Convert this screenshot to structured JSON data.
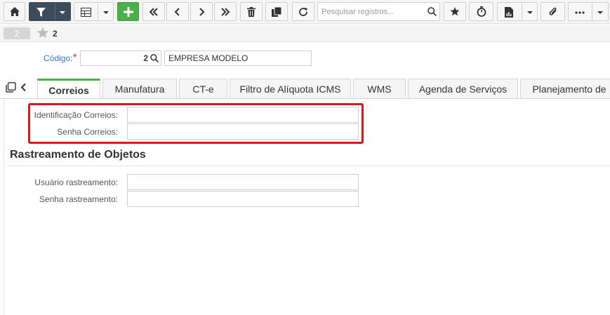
{
  "toolbar": {
    "search_placeholder": "Pesquisar registros..."
  },
  "record": {
    "badge": "2",
    "title": "2"
  },
  "header": {
    "codigo_label": "Código:",
    "required_mark": "*",
    "codigo_value": "2",
    "empresa_value": "EMPRESA MODELO"
  },
  "tabs": [
    {
      "label": "Correios",
      "active": true
    },
    {
      "label": "Manufatura",
      "active": false
    },
    {
      "label": "CT-e",
      "active": false
    },
    {
      "label": "Filtro de Alíquota ICMS",
      "active": false
    },
    {
      "label": "WMS",
      "active": false
    },
    {
      "label": "Agenda de Serviços",
      "active": false
    },
    {
      "label": "Planejamento de",
      "active": false
    }
  ],
  "correios": {
    "identificacao_label": "Identificação Correios:",
    "identificacao_value": "",
    "senha_label": "Senha Correios:",
    "senha_value": ""
  },
  "rastreamento": {
    "title": "Rastreamento de Objetos",
    "usuario_label": "Usuário rastreamento:",
    "usuario_value": "",
    "senha_label": "Senha rastreamento:",
    "senha_value": ""
  },
  "colors": {
    "accent_green": "#4cb04a",
    "toolbar_dark": "#3d4c5d",
    "highlight_red": "#d11a1a",
    "link_blue": "#3377cc"
  }
}
